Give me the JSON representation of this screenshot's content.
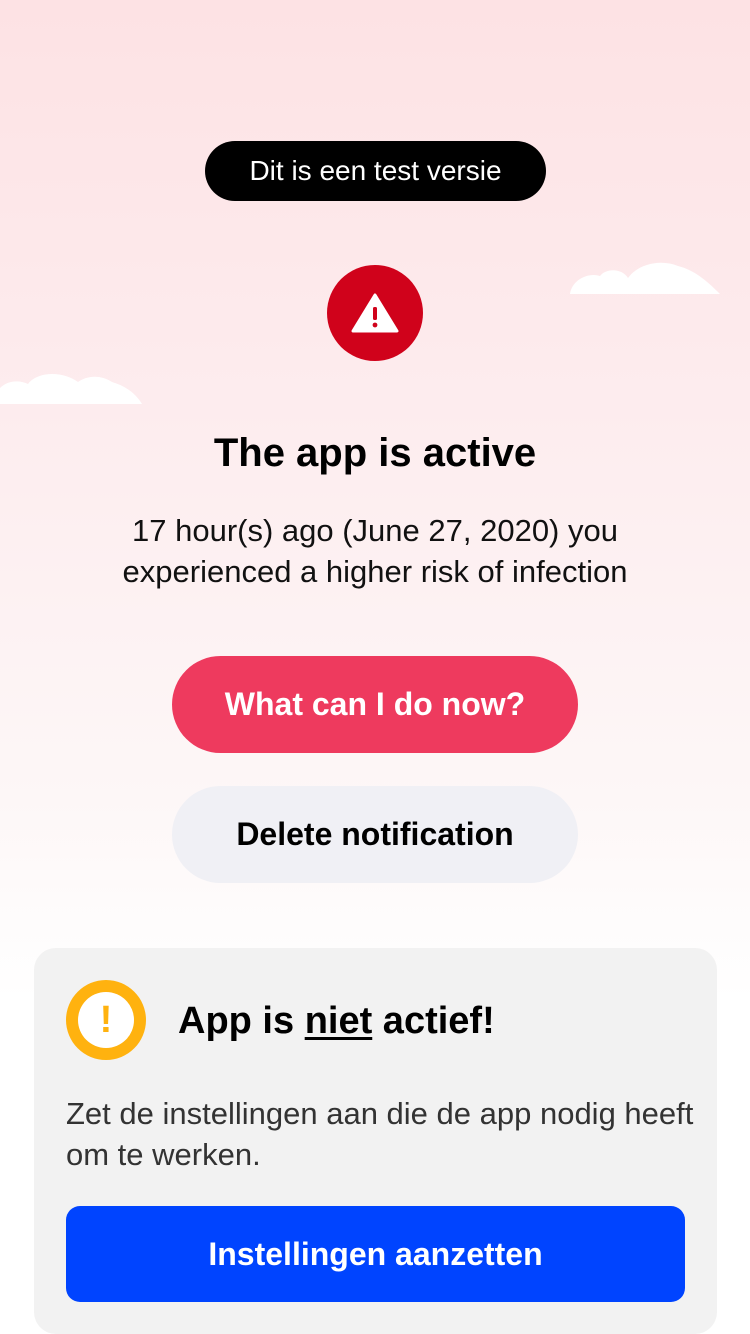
{
  "test_badge": {
    "label": "Dit is een test versie"
  },
  "status": {
    "icon": "warning-triangle-icon",
    "icon_color": "#d0021b",
    "title": "The app is active",
    "message": "17 hour(s) ago (June 27, 2020) you experienced a higher risk of infection"
  },
  "actions": {
    "primary_label": "What can I do now?",
    "primary_color": "#ee3a5e",
    "secondary_label": "Delete notification"
  },
  "alert_card": {
    "icon": "exclamation-circle-icon",
    "icon_color": "#ffb20f",
    "title_prefix": "App is ",
    "title_emphasis": "niet",
    "title_suffix": " actief!",
    "message": "Zet de instellingen aan die de app nodig heeft om te werken.",
    "button_label": "Instellingen aanzetten",
    "button_color": "#0044ff"
  }
}
